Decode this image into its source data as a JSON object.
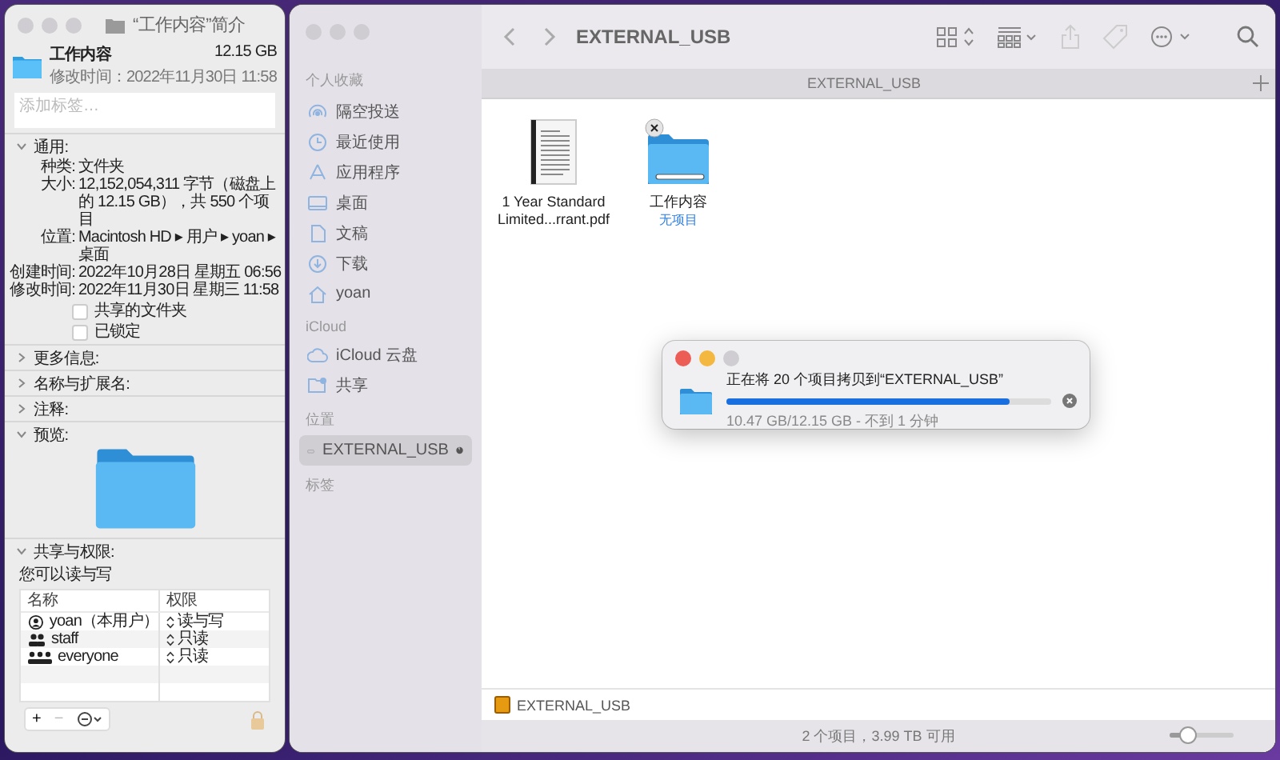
{
  "info_window": {
    "title": "“工作内容”简介",
    "name": "工作内容",
    "size": "12.15 GB",
    "modified": "修改时间：2022年11月30日 11:58",
    "tags_placeholder": "添加标签…",
    "sections": [
      {
        "kind": "general",
        "label": "通用:",
        "expanded": true,
        "fields": [
          {
            "label": "种类:",
            "value": "文件夹"
          },
          {
            "label": "大小:",
            "value": "12,152,054,311 字节（磁盘上的 12.15 GB），共 550 个项目"
          },
          {
            "label": "位置:",
            "value": "Macintosh HD ▸ 用户 ▸ yoan ▸ 桌面"
          },
          {
            "label": "创建时间:",
            "value": "2022年10月28日 星期五 06:56"
          },
          {
            "label": "修改时间:",
            "value": "2022年11月30日 星期三 11:58"
          }
        ],
        "checkboxes": [
          {
            "label": "共享的文件夹",
            "checked": false
          },
          {
            "label": "已锁定",
            "checked": false
          }
        ]
      },
      {
        "label": "更多信息:",
        "expanded": false
      },
      {
        "label": "名称与扩展名:",
        "expanded": false
      },
      {
        "label": "注释:",
        "expanded": false
      },
      {
        "kind": "preview",
        "label": "预览:",
        "expanded": true
      },
      {
        "kind": "sharing",
        "label": "共享与权限:",
        "expanded": true,
        "note": "您可以读与写",
        "columns": [
          "名称",
          "权限"
        ],
        "rows": [
          {
            "kind": "user",
            "name": "yoan（本用户）",
            "permission": "读与写"
          },
          {
            "kind": "group",
            "name": "staff",
            "permission": "只读"
          },
          {
            "kind": "everyone",
            "name": "everyone",
            "permission": "只读"
          }
        ]
      }
    ],
    "buttons": [
      "+",
      "−"
    ]
  },
  "finder": {
    "title": "EXTERNAL_USB",
    "tab": "EXTERNAL_USB",
    "sidebar": [
      {
        "heading": "个人收藏",
        "items": [
          {
            "kind": "airdrop",
            "label": "隔空投送",
            "selected": false
          },
          {
            "kind": "clock",
            "label": "最近使用",
            "selected": false
          },
          {
            "kind": "apps",
            "label": "应用程序",
            "selected": false
          },
          {
            "kind": "desktop",
            "label": "桌面",
            "selected": false
          },
          {
            "kind": "doc",
            "label": "文稿",
            "selected": false
          },
          {
            "kind": "download",
            "label": "下载",
            "selected": false
          },
          {
            "kind": "home",
            "label": "yoan",
            "selected": false
          }
        ]
      },
      {
        "heading": "iCloud",
        "items": [
          {
            "kind": "cloud",
            "label": "iCloud 云盘",
            "selected": false
          },
          {
            "kind": "shared",
            "label": "共享",
            "selected": false
          }
        ]
      },
      {
        "heading": "位置",
        "items": [
          {
            "kind": "drive",
            "label": "EXTERNAL_USB",
            "selected": true
          }
        ]
      },
      {
        "heading": "标签"
      }
    ],
    "files": [
      {
        "kind": "pdf",
        "name": "1 Year Standard Limited...rrant.pdf"
      },
      {
        "kind": "folder",
        "name": "工作内容",
        "subtitle": "无项目"
      }
    ],
    "path_bar": "EXTERNAL_USB",
    "status_bar": "2 个项目，3.99 TB 可用",
    "zoom_slider": {
      "level": 0.3
    },
    "copy_dialog": {
      "message": "正在将 20 个项目拷贝到“EXTERNAL_USB”",
      "level": 0.87,
      "detail": "10.47 GB/12.15 GB - 不到 1 分钟"
    }
  }
}
